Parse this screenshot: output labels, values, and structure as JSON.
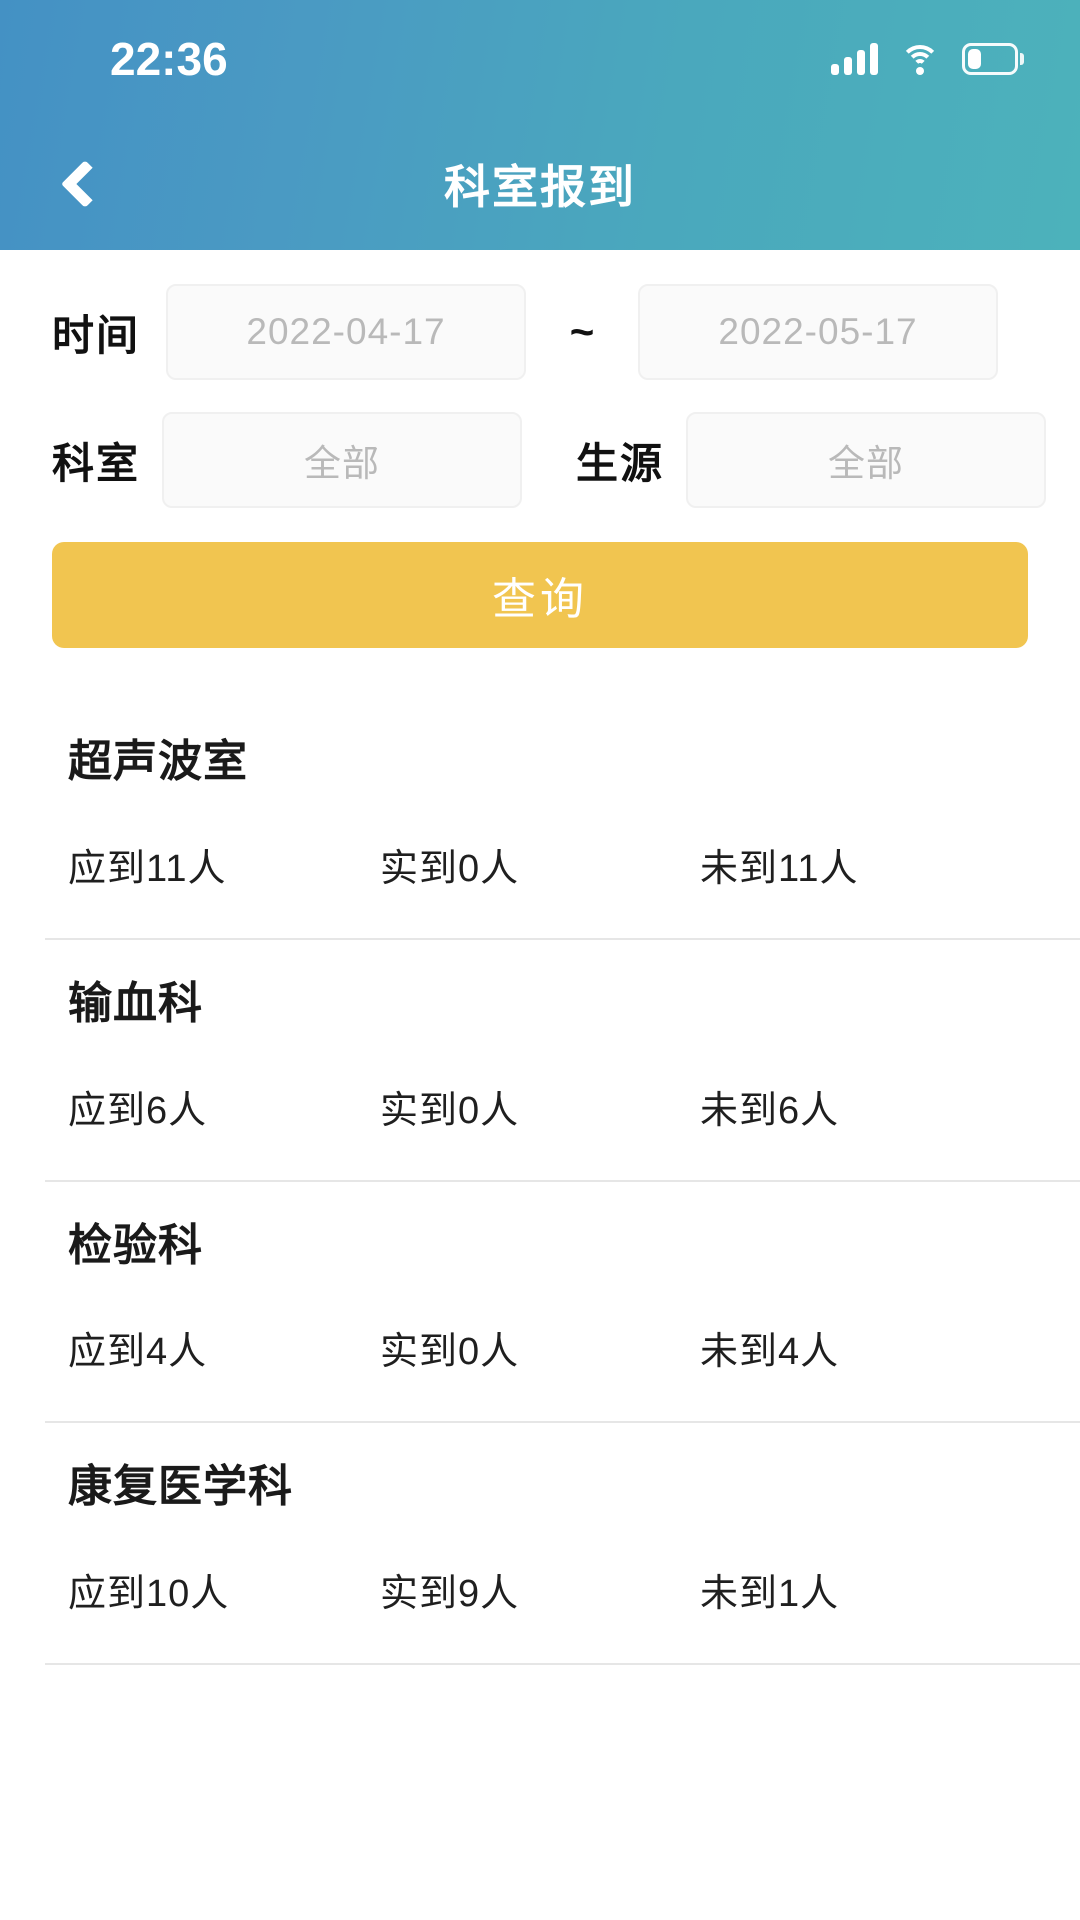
{
  "statusbar": {
    "time": "22:36",
    "signal_icon": "cellular-signal-icon",
    "wifi_icon": "wifi-icon",
    "battery_icon": "battery-icon"
  },
  "header": {
    "title": "科室报到",
    "back_icon": "chevron-left-icon",
    "gradient_from": "#4491c4",
    "gradient_to": "#4cb2bb"
  },
  "filters": {
    "time_label": "时间",
    "date_start_placeholder": "2022-04-17",
    "date_start_value": "",
    "range_separator": "~",
    "date_end_placeholder": "2022-05-17",
    "date_end_value": "",
    "dept_label": "科室",
    "dept_placeholder": "全部",
    "dept_value": "",
    "source_label": "生源",
    "source_placeholder": "全部",
    "source_value": "",
    "query_label": "查询",
    "query_color": "#f1c550"
  },
  "list": {
    "items": [
      {
        "name": "超声波室",
        "expected": "应到11人",
        "actual": "实到0人",
        "absent": "未到11人"
      },
      {
        "name": "输血科",
        "expected": "应到6人",
        "actual": "实到0人",
        "absent": "未到6人"
      },
      {
        "name": "检验科",
        "expected": "应到4人",
        "actual": "实到0人",
        "absent": "未到4人"
      },
      {
        "name": "康复医学科",
        "expected": "应到10人",
        "actual": "实到9人",
        "absent": "未到1人"
      }
    ]
  }
}
